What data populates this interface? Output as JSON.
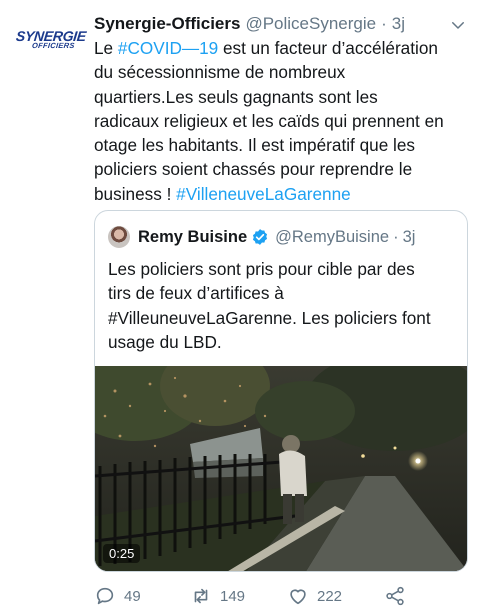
{
  "tweet": {
    "avatar_logo": {
      "line1": "SYNERGIE",
      "line2": "OFFICIERS",
      "color": "#1b3a8c"
    },
    "author_name": "Synergie-Officiers",
    "author_handle": "@PoliceSynergie",
    "separator": "·",
    "time": "3j",
    "menu_icon": "chevron-down-icon",
    "text_lines": {
      "l1_pre": "Le ",
      "l1_tag": "#COVID—19",
      "l1_post": " est un facteur d’accélération",
      "l2": "du sécessionnisme de nombreux",
      "l3": "quartiers.Les seuls gagnants sont les",
      "l4": "radicaux religieux et les caïds qui prennent en",
      "l5": "otage les habitants. Il est impératif que les",
      "l6": "policiers soient chassés pour reprendre le",
      "l7_pre": "business ! ",
      "l7_tag": "#VilleneuveLaGarenne"
    },
    "hashtag_color": "#1da1f2"
  },
  "quoted_tweet": {
    "author_name": "Remy Buisine",
    "verified_icon": "verified-badge-icon",
    "author_handle": "@RemyBuisine",
    "separator": "·",
    "time": "3j",
    "text_lines": {
      "l1": "Les policiers sont pris pour cible par des",
      "l2": "tirs de feux d’artifices à",
      "l3": "#VilleuneuveLaGarenne. Les policiers font",
      "l4": "usage du LBD."
    },
    "video": {
      "duration": "0:25"
    }
  },
  "actions": {
    "reply": {
      "icon": "reply-icon",
      "count": "49"
    },
    "retweet": {
      "icon": "retweet-icon",
      "count": "149"
    },
    "like": {
      "icon": "heart-icon",
      "count": "222"
    },
    "share": {
      "icon": "share-icon"
    }
  },
  "colors": {
    "text": "#14171a",
    "secondary": "#657786",
    "accent": "#1da1f2",
    "border": "#ccd6dd"
  }
}
